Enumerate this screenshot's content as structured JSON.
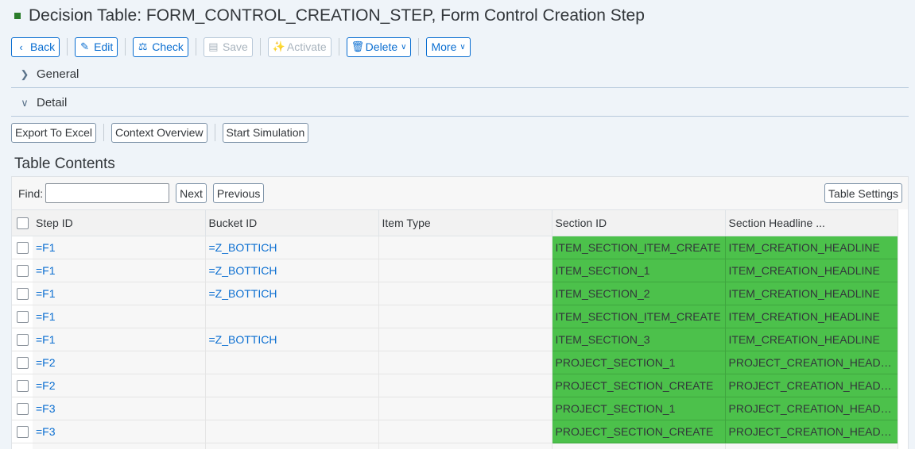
{
  "title": "Decision Table: FORM_CONTROL_CREATION_STEP, Form Control Creation Step",
  "toolbar": {
    "back": "Back",
    "edit": "Edit",
    "check": "Check",
    "save": "Save",
    "activate": "Activate",
    "delete": "Delete",
    "more": "More"
  },
  "sections": {
    "general": "General",
    "detail": "Detail"
  },
  "detail_toolbar": {
    "export": "Export To Excel",
    "context": "Context Overview",
    "simulation": "Start Simulation"
  },
  "table": {
    "title": "Table Contents",
    "find_label": "Find:",
    "find_value": "",
    "next": "Next",
    "previous": "Previous",
    "settings": "Table Settings",
    "columns": [
      "Step ID",
      "Bucket ID",
      "Item Type",
      "Section ID",
      "Section Headline ..."
    ],
    "rows": [
      [
        "=F1",
        "=Z_BOTTICH",
        "",
        "ITEM_SECTION_ITEM_CREATE",
        "ITEM_CREATION_HEADLINE"
      ],
      [
        "=F1",
        "=Z_BOTTICH",
        "",
        "ITEM_SECTION_1",
        "ITEM_CREATION_HEADLINE"
      ],
      [
        "=F1",
        "=Z_BOTTICH",
        "",
        "ITEM_SECTION_2",
        "ITEM_CREATION_HEADLINE"
      ],
      [
        "=F1",
        "",
        "",
        "ITEM_SECTION_ITEM_CREATE",
        "ITEM_CREATION_HEADLINE"
      ],
      [
        "=F1",
        "=Z_BOTTICH",
        "",
        "ITEM_SECTION_3",
        "ITEM_CREATION_HEADLINE"
      ],
      [
        "=F2",
        "",
        "",
        "PROJECT_SECTION_1",
        "PROJECT_CREATION_HEADLI..."
      ],
      [
        "=F2",
        "",
        "",
        "PROJECT_SECTION_CREATE",
        "PROJECT_CREATION_HEADLI..."
      ],
      [
        "=F3",
        "",
        "",
        "PROJECT_SECTION_1",
        "PROJECT_CREATION_HEADLI..."
      ],
      [
        "=F3",
        "",
        "",
        "PROJECT_SECTION_CREATE",
        "PROJECT_CREATION_HEADLI..."
      ],
      [
        "",
        "",
        "",
        "",
        ""
      ]
    ]
  },
  "colors": {
    "accent": "#0a6ed1",
    "result_cell": "#4cc14b",
    "background": "#eff4f9"
  }
}
